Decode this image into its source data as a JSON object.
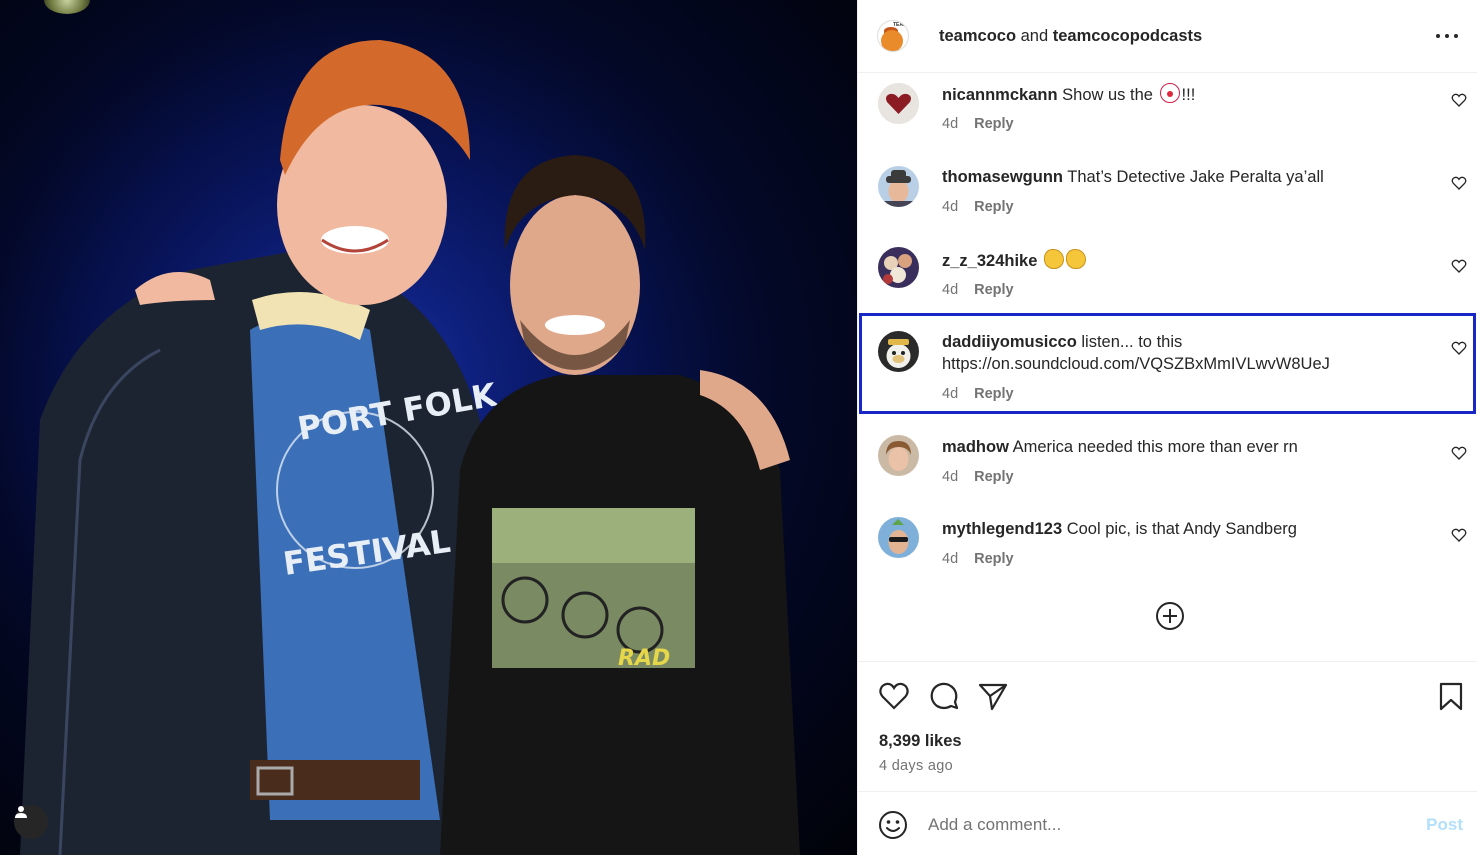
{
  "post": {
    "header": {
      "user1": "teamcoco",
      "joiner": " and ",
      "user2": "teamcocopodcasts",
      "avatar_text": "TEAM"
    },
    "photo": {
      "shirt_left": "PORT FOLK FESTIVAL",
      "shirt_right": "RAD"
    },
    "comments": [
      {
        "user": "nicannmckann",
        "text": " Show us the ",
        "suffix": "!!!",
        "emoji": "clown-face-icon",
        "age": "4d",
        "reply": "Reply"
      },
      {
        "user": "thomasewgunn",
        "text": " That’s Detective Jake Peralta ya’all",
        "age": "4d",
        "reply": "Reply"
      },
      {
        "user": "z_z_324hike",
        "text": " ",
        "emoji": "clapping-hands-icon",
        "age": "4d",
        "reply": "Reply"
      },
      {
        "user": "daddiiyomusicco",
        "text": " listen... to this",
        "link": "https://on.soundcloud.com/VQSZBxMmIVLwvW8UeJ",
        "age": "4d",
        "reply": "Reply"
      },
      {
        "user": "madhow",
        "text": " America needed this more than ever rn",
        "age": "4d",
        "reply": "Reply"
      },
      {
        "user": "mythlegend123",
        "text": " Cool pic, is that Andy Sandberg",
        "age": "4d",
        "reply": "Reply"
      }
    ],
    "likes": "8,399 likes",
    "date": "4 days ago",
    "comment_box": {
      "placeholder": "Add a comment...",
      "post_label": "Post"
    },
    "colors": {
      "highlight": "#1826c6",
      "post_disabled": "#b2dffc",
      "meta_text": "#737373"
    }
  }
}
